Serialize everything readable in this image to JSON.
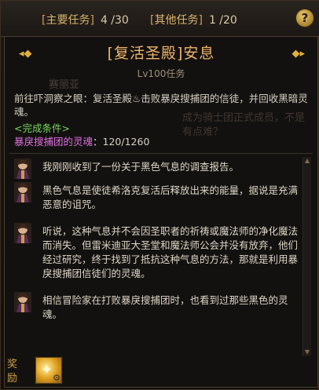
{
  "tabs": {
    "main": {
      "label": "主要任务",
      "count": "4 /30"
    },
    "other": {
      "label": "其他任务",
      "count": "1 /20"
    },
    "help_icon": "help-icon"
  },
  "quest": {
    "title": "[复活圣殿]安息",
    "level": "Lv100任务",
    "description": "前往吓洞察之眼：复活圣殿♨击败暴戾搜捕团的信徒，并回收黑暗灵魂。",
    "conditions_title": "<完成条件>",
    "condition_name": "暴戾搜捕团的灵魂",
    "condition_progress": "：120/1260"
  },
  "background": {
    "npc_name": "赛丽亚",
    "side_text": "成为骑士团正式成员，不是有点难？"
  },
  "dialogue": [
    {
      "text": "我刚刚收到了一份关于黑色气息的调查报告。"
    },
    {
      "text": "黑色气息是使徒希洛克复活后释放出来的能量，据说是充满恶意的诅咒。"
    },
    {
      "text": "听说，这种气息并不会因圣职者的祈祷或魔法师的净化魔法而消失。但雷米迪亚大圣堂和魔法师公会并没有放弃，他们经过研究，终于找到了抵抗这种气息的方法，那就是利用暴戾搜捕团信徒们的灵魂。"
    },
    {
      "text": "相信冒险家在打败暴戾搜捕团时，也看到过那些黑色的灵魂。"
    }
  ],
  "reward": {
    "label": "奖励",
    "item_icon": "reward-item-icon"
  },
  "colors": {
    "title": "#f0b46a",
    "condition": "#78d85a",
    "condition_name": "#e070e0",
    "tab": "#d9b66c"
  }
}
